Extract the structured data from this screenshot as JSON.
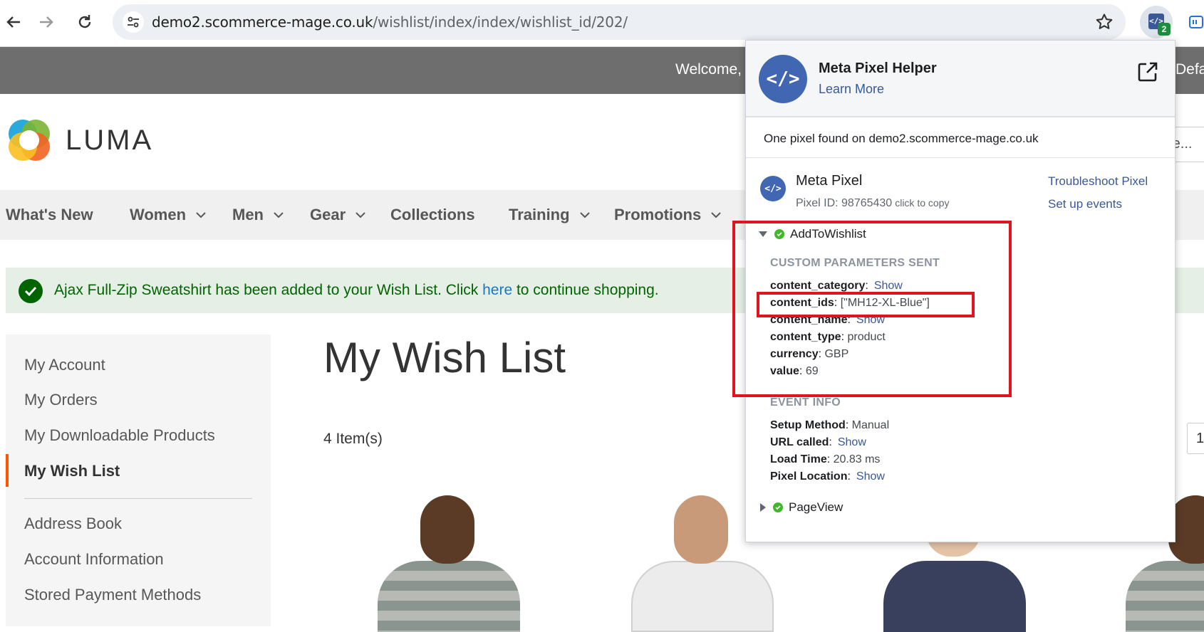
{
  "browser": {
    "url_host": "demo2.scommerce-mage.co.uk",
    "url_path": "/wishlist/index/index/wishlist_id/202/",
    "extension_badge": "2"
  },
  "header": {
    "welcome": "Welcome,",
    "right_text": "Defa"
  },
  "logo": {
    "text": "LUMA"
  },
  "search": {
    "placeholder": "re..."
  },
  "nav": {
    "items": [
      "What's New",
      "Women",
      "Men",
      "Gear",
      "Collections",
      "Training",
      "Promotions"
    ]
  },
  "alert": {
    "text_before": "Ajax Full-Zip Sweatshirt has been added to your Wish List. Click ",
    "link": "here",
    "text_after": " to continue shopping."
  },
  "sidebar": {
    "items": [
      "My Account",
      "My Orders",
      "My Downloadable Products",
      "My Wish List",
      "Address Book",
      "Account Information",
      "Stored Payment Methods"
    ],
    "active": "My Wish List"
  },
  "main": {
    "title": "My Wish List",
    "items_count": "4 Item(s)",
    "pager": "1"
  },
  "popup": {
    "title": "Meta Pixel Helper",
    "learn_more": "Learn More",
    "found": "One pixel found on demo2.scommerce-mage.co.uk",
    "pixel_name": "Meta Pixel",
    "pixel_id": "Pixel ID: 98765430",
    "click_to_copy": "click to copy",
    "troubleshoot": "Troubleshoot Pixel",
    "setup_events": "Set up events",
    "event1": "AddToWishlist",
    "custom_params_heading": "CUSTOM PARAMETERS SENT",
    "params": {
      "content_category": {
        "key": "content_category",
        "link": "Show"
      },
      "content_ids": {
        "key": "content_ids",
        "value": "[\"MH12-XL-Blue\"]"
      },
      "content_name": {
        "key": "content_name",
        "link": "Show"
      },
      "content_type": {
        "key": "content_type",
        "value": "product"
      },
      "currency": {
        "key": "currency",
        "value": "GBP"
      },
      "value": {
        "key": "value",
        "value": "69"
      }
    },
    "event_info_heading": "EVENT INFO",
    "event_info": {
      "setup_method": {
        "key": "Setup Method",
        "value": "Manual"
      },
      "url_called": {
        "key": "URL called",
        "link": "Show"
      },
      "load_time": {
        "key": "Load Time",
        "value": "20.83 ms"
      },
      "pixel_location": {
        "key": "Pixel Location",
        "link": "Show"
      }
    },
    "event2": "PageView"
  },
  "colors": {
    "accent": "#ff5501",
    "link": "#1979c3",
    "success": "#006400",
    "facebook_blue": "#4267b2",
    "highlight": "#e0131f"
  }
}
